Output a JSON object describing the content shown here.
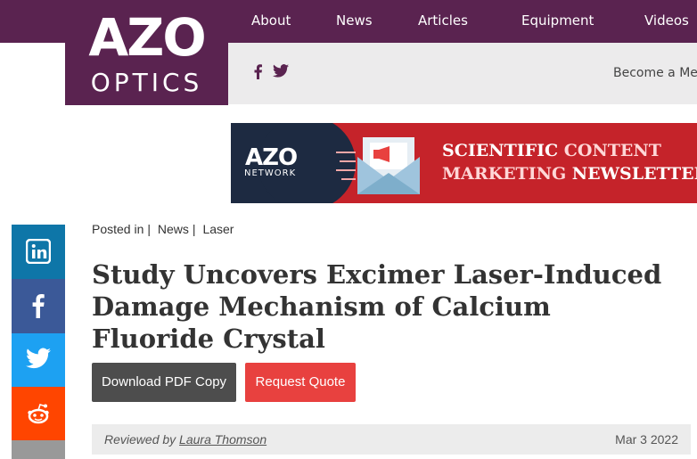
{
  "header": {
    "logo_main": "AZO",
    "logo_sub": "OPTICS",
    "nav": [
      "About",
      "News",
      "Articles",
      "Equipment",
      "Videos"
    ],
    "become_member": "Become a Mem"
  },
  "banner": {
    "brand": "AZO",
    "network": "NETWORK",
    "line1_a": "SCIENTIFIC ",
    "line1_b": "CONTENT",
    "line2_a": "MARKETING ",
    "line2_b": "NEWSLETTER"
  },
  "article": {
    "posted_in": "Posted in",
    "category1": "News",
    "category2": "Laser",
    "title": "Study Uncovers Excimer Laser-Induced Damage Mechanism of Calcium Fluoride Crystal",
    "download_btn": "Download PDF Copy",
    "quote_btn": "Request Quote",
    "reviewed_by": "Reviewed by",
    "reviewer": "Laura Thomson",
    "date": "Mar 3 2022"
  },
  "colors": {
    "brand_purple": "#5a2350",
    "linkedin": "#0e76a8",
    "facebook": "#3b5998",
    "twitter": "#1da1f2",
    "reddit": "#ff4500"
  },
  "icons": [
    "facebook-icon",
    "twitter-icon",
    "linkedin-icon",
    "reddit-icon",
    "megaphone-envelope-icon"
  ]
}
